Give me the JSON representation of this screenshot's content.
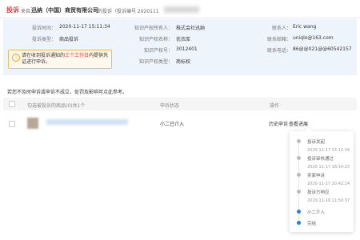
{
  "header": {
    "badge": "投诉",
    "from": "来自",
    "company": "迅纳（中国）商贸有限公司",
    "rest": "的投诉（投诉编号 2020111"
  },
  "info": {
    "complaint_time_label": "投诉时间：",
    "complaint_time": "2020-11-17 15:11:34",
    "complaint_type_label": "投诉类型：",
    "complaint_type": "商品投诉",
    "owner_label": "知识产权所有人：",
    "owner": "株式会社迅纳",
    "ip_name_label": "知识产权名称：",
    "ip_name": "优衣库",
    "ip_number_label": "知识产权号：",
    "ip_number": "3012401",
    "ip_type_label": "知识产权类型：",
    "ip_type": "商标权",
    "contact_label": "联系人：",
    "contact": "Eric wang",
    "email_label": "联系邮箱：",
    "email": "uniqlo@163.com",
    "phone_label": "联系电话：",
    "phone": "86@@021@@60542157",
    "tip_before": "请在收到投诉通知的",
    "tip_highlight": "三个工作日",
    "tip_after": "内提供凭证进行申诉。"
  },
  "hint": "若您不及时申诉或申诉不成立，处罚及影响可点此参考。",
  "table": {
    "col_goods": "勾选被投诉的商品(0)共1个",
    "col_status": "申诉状态",
    "col_action": "操作",
    "row_status": "小二已介入",
    "action_history": "历史申诉",
    "action_progress": "查看进展"
  },
  "timeline": [
    {
      "title": "投诉发起",
      "time": "2020-11-17 15:11:34",
      "active": false
    },
    {
      "title": "投诉审核通过",
      "time": "2020-11-17 18:14:23",
      "active": false
    },
    {
      "title": "卖家申诉",
      "time": "2020-11-17 20:42:24",
      "active": false
    },
    {
      "title": "投诉方响应",
      "time": "2020-11-18 11:50:37",
      "active": false
    },
    {
      "title": "小二介入",
      "time": "",
      "active": true
    },
    {
      "title": "完结",
      "time": "",
      "active": true
    }
  ]
}
